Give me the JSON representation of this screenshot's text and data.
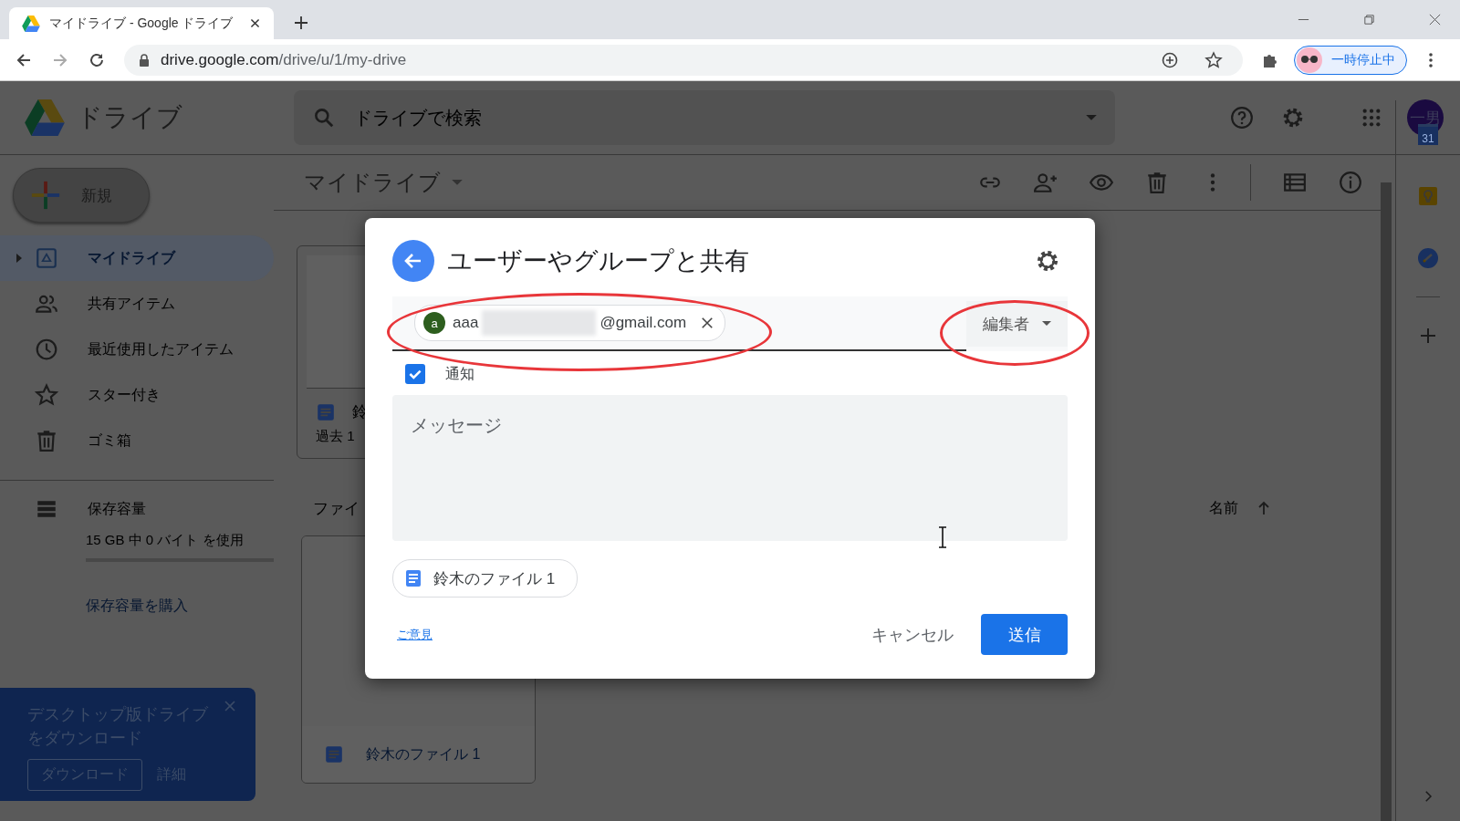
{
  "browser": {
    "tab_title": "マイドライブ - Google ドライブ",
    "url_host": "drive.google.com",
    "url_path": "/drive/u/1/my-drive",
    "profile_label": "一時停止中"
  },
  "header": {
    "app_name": "ドライブ",
    "search_placeholder": "ドライブで検索",
    "avatar": "一男"
  },
  "new_button": "新規",
  "sidebar": {
    "items": [
      {
        "label": "マイドライブ",
        "selected": true
      },
      {
        "label": "共有アイテム",
        "selected": false
      },
      {
        "label": "最近使用したアイテム",
        "selected": false
      },
      {
        "label": "スター付き",
        "selected": false
      },
      {
        "label": "ゴミ箱",
        "selected": false
      }
    ],
    "storage_label": "保存容量",
    "storage_usage": "15 GB 中 0 バイト を使用",
    "buy_storage": "保存容量を購入"
  },
  "promo": {
    "text": "デスクトップ版ドライブをダウンロード",
    "download": "ダウンロード",
    "details": "詳細"
  },
  "toolbar": {
    "title": "マイドライブ"
  },
  "content": {
    "quick_card_name": "鈴",
    "quick_card_meta": "過去 1",
    "files_heading": "ファイ",
    "sort_label": "名前",
    "file_card_name": "鈴木のファイル 1"
  },
  "side_panel": {
    "calendar_day": "31"
  },
  "dialog": {
    "title": "ユーザーやグループと共有",
    "recipient": {
      "initial": "a",
      "email_start": "aaa",
      "email_end": "@gmail.com",
      "redacted": true
    },
    "role": "編集者",
    "notify": {
      "label": "通知",
      "checked": true
    },
    "message_placeholder": "メッセージ",
    "file_chip": "鈴木のファイル 1",
    "feedback_link": "ご意見",
    "cancel": "キャンセル",
    "send": "送信"
  },
  "annotations": [
    {
      "kind": "ellipse"
    },
    {
      "kind": "ellipse"
    }
  ]
}
